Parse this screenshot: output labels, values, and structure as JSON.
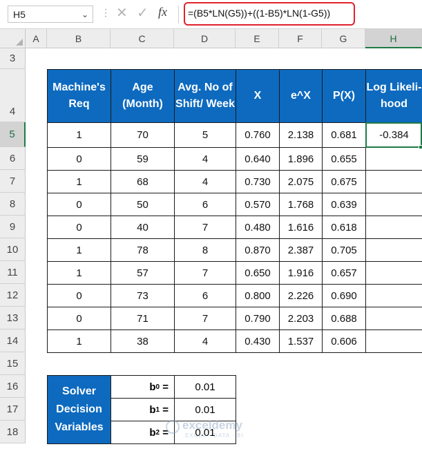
{
  "formula_bar": {
    "name_box": "H5",
    "dots": "⋮",
    "cancel_icon": "✕",
    "enter_icon": "✓",
    "fx_label": "fx",
    "formula": "=(B5*LN(G5))+((1-B5)*LN(1-G5))"
  },
  "columns": [
    "A",
    "B",
    "C",
    "D",
    "E",
    "F",
    "G",
    "H"
  ],
  "rows": [
    "3",
    "4",
    "5",
    "6",
    "7",
    "8",
    "9",
    "10",
    "11",
    "12",
    "13",
    "14",
    "15",
    "16",
    "17",
    "18"
  ],
  "table": {
    "headers": [
      "Machine's Req",
      "Age (Month)",
      "Avg. No of Shift/ Week",
      "X",
      "e^X",
      "P(X)",
      "Log Likeli- hood"
    ],
    "rows": [
      [
        "1",
        "70",
        "5",
        "0.760",
        "2.138",
        "0.681",
        "-0.384"
      ],
      [
        "0",
        "59",
        "4",
        "0.640",
        "1.896",
        "0.655",
        ""
      ],
      [
        "1",
        "68",
        "4",
        "0.730",
        "2.075",
        "0.675",
        ""
      ],
      [
        "0",
        "50",
        "6",
        "0.570",
        "1.768",
        "0.639",
        ""
      ],
      [
        "0",
        "40",
        "7",
        "0.480",
        "1.616",
        "0.618",
        ""
      ],
      [
        "1",
        "78",
        "8",
        "0.870",
        "2.387",
        "0.705",
        ""
      ],
      [
        "1",
        "57",
        "7",
        "0.650",
        "1.916",
        "0.657",
        ""
      ],
      [
        "0",
        "73",
        "6",
        "0.800",
        "2.226",
        "0.690",
        ""
      ],
      [
        "0",
        "71",
        "7",
        "0.790",
        "2.203",
        "0.688",
        ""
      ],
      [
        "1",
        "38",
        "4",
        "0.430",
        "1.537",
        "0.606",
        ""
      ]
    ]
  },
  "solver": {
    "title": "Solver Decision Variables",
    "vars": [
      {
        "label": "b",
        "sub": "0",
        "eq": " =",
        "value": "0.01"
      },
      {
        "label": "b",
        "sub": "1",
        "eq": " =",
        "value": "0.01"
      },
      {
        "label": "b",
        "sub": "2",
        "eq": " =",
        "value": "0.01"
      }
    ]
  },
  "watermark": {
    "name": "exceldemy",
    "sub": "EXCEL · DATA · BI"
  },
  "colors": {
    "header_blue": "#0d6abf",
    "selection_green": "#1d7a44",
    "formula_red": "#e0212e"
  }
}
